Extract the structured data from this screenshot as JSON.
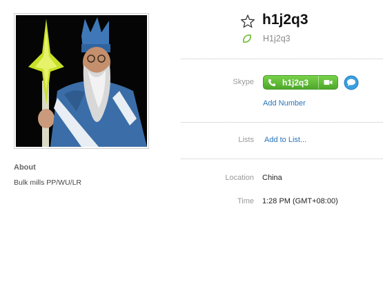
{
  "profile": {
    "display_name": "h1j2q3",
    "skype_name": "H1j2q3",
    "about_title": "About",
    "about_text": "Bulk mills PP/WU/LR"
  },
  "fields": {
    "skype_label": "Skype",
    "call_button_label": "h1j2q3",
    "add_number_link": "Add Number",
    "lists_label": "Lists",
    "add_to_list_link": "Add to List...",
    "location_label": "Location",
    "location_value": "China",
    "time_label": "Time",
    "time_value": "1:28 PM (GMT+08:00)"
  },
  "icons": {
    "favorite": "star-outline-icon",
    "mood": "green-leaf-icon",
    "call": "phone-icon",
    "video": "video-camera-icon",
    "chat": "chat-bubble-icon"
  },
  "colors": {
    "call_green": "#5cb83a",
    "link_blue": "#2574b8",
    "chat_blue": "#3a9ee0",
    "label_gray": "#999999"
  }
}
